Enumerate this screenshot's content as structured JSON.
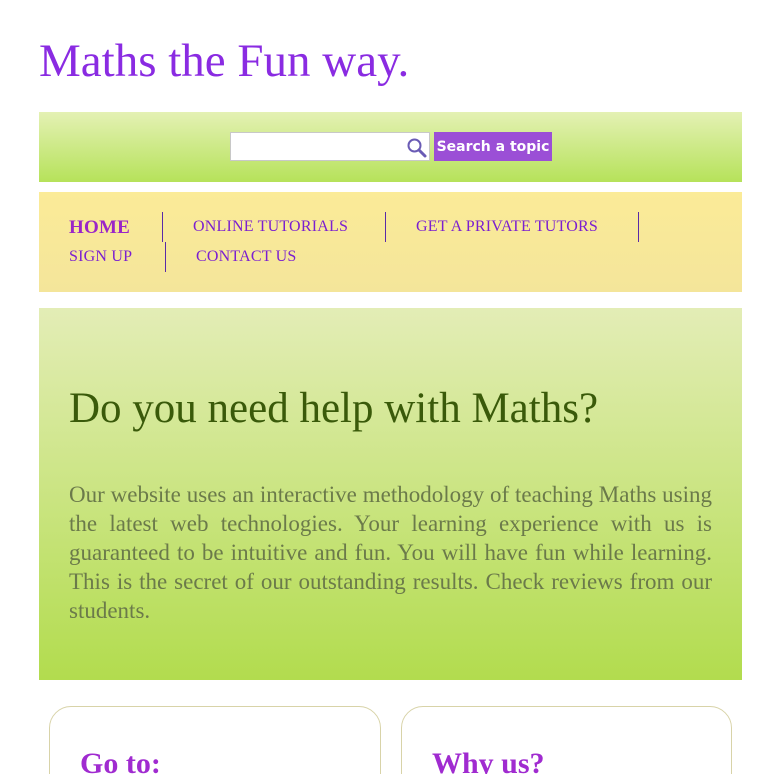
{
  "header": {
    "title": "Maths the Fun way."
  },
  "search": {
    "placeholder": "",
    "value": "",
    "button_label": "Search a topic"
  },
  "nav": {
    "items": [
      {
        "label": "HOME"
      },
      {
        "label": "ONLINE TUTORIALS"
      },
      {
        "label": "GET A PRIVATE TUTORS"
      },
      {
        "label": "SIGN UP"
      },
      {
        "label": "CONTACT US"
      }
    ]
  },
  "hero": {
    "title": "Do you need help with Maths?",
    "text": "Our website uses an interactive methodology of teaching Maths using the latest web technologies. Your learning experience with us is guaranteed to be intuitive and fun. You will have fun while learning. This is the secret of our outstanding results. Check reviews from our students."
  },
  "cards": [
    {
      "title": "Go to:"
    },
    {
      "title": "Why us?"
    }
  ],
  "colors": {
    "title": "#8a2be2",
    "search_button": "#9b4fd6",
    "nav_text": "#7b1fd0",
    "hero_title": "#3a5a0a",
    "card_title": "#a02bd0"
  }
}
